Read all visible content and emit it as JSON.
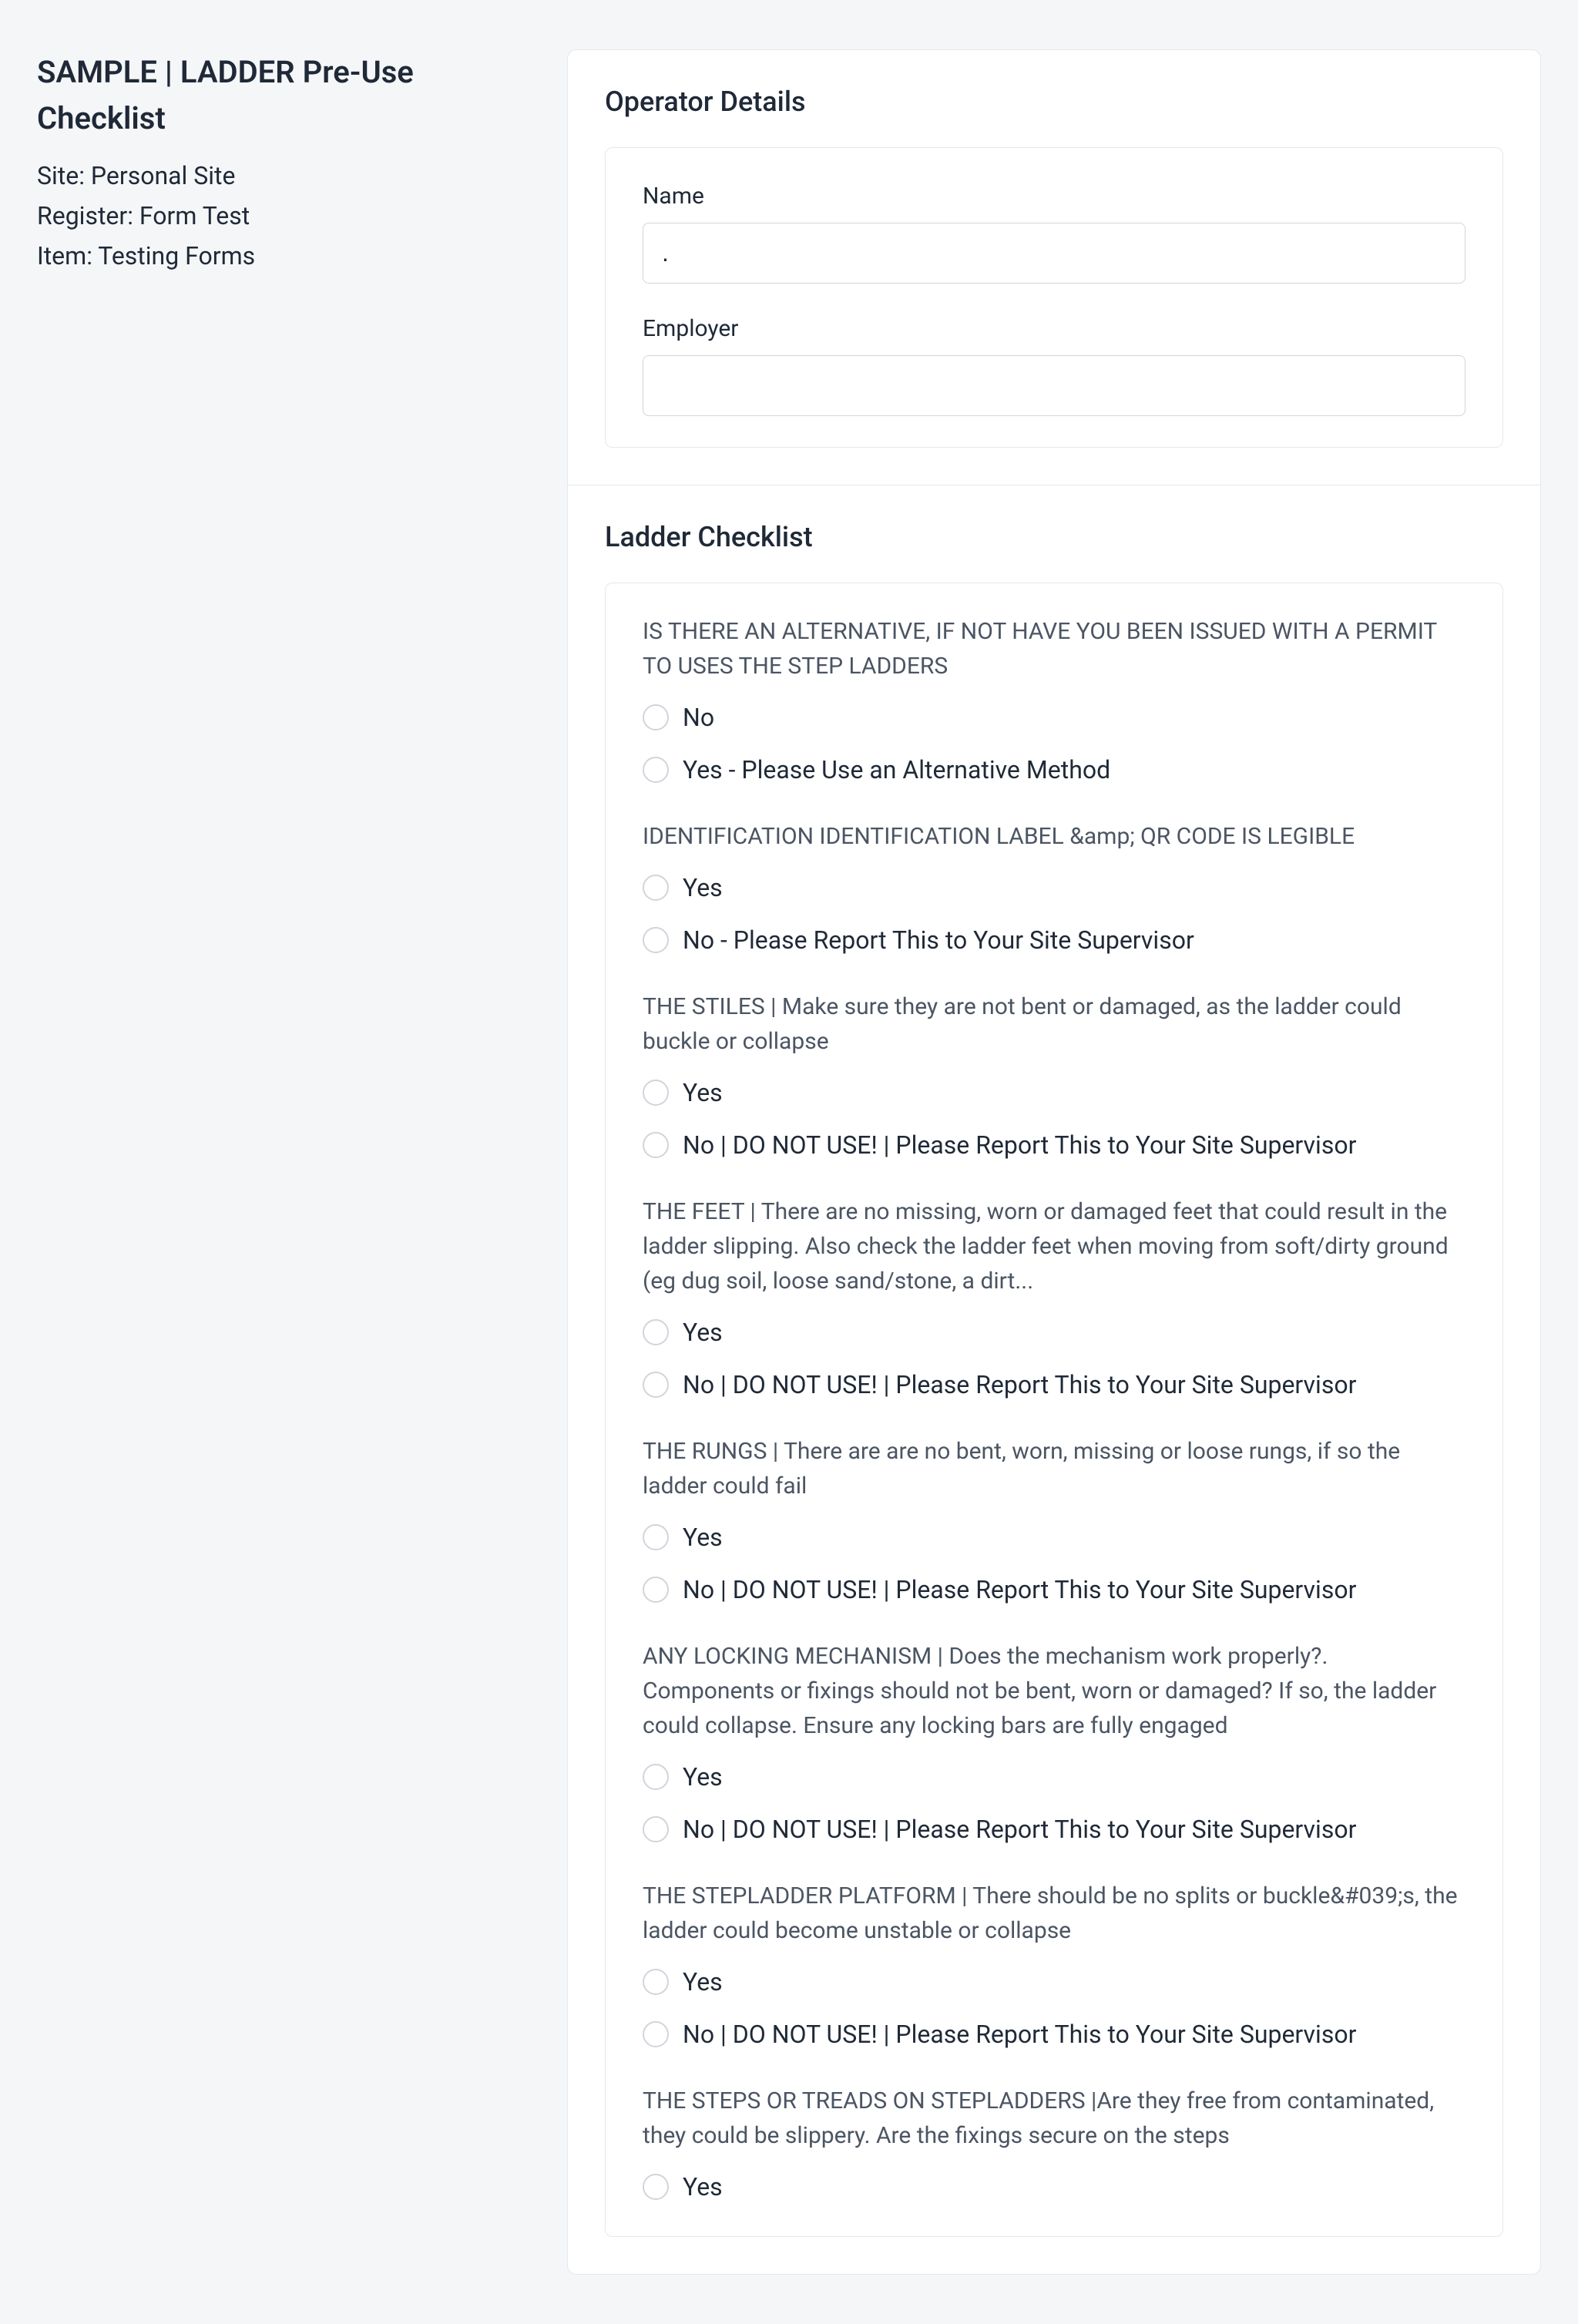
{
  "header": {
    "title": "SAMPLE | LADDER Pre-Use Checklist",
    "site_label": "Site:",
    "site_value": "Personal Site",
    "register_label": "Register:",
    "register_value": "Form Test",
    "item_label": "Item:",
    "item_value": "Testing Forms"
  },
  "sections": {
    "operator": {
      "title": "Operator Details",
      "fields": {
        "name": {
          "label": "Name",
          "value": "."
        },
        "employer": {
          "label": "Employer",
          "value": ""
        }
      }
    },
    "checklist": {
      "title": "Ladder Checklist",
      "questions": [
        {
          "text": "IS THERE AN ALTERNATIVE, IF NOT HAVE YOU BEEN ISSUED WITH A PERMIT TO USES THE STEP LADDERS",
          "options": [
            "No",
            "Yes - Please Use an Alternative Method"
          ]
        },
        {
          "text": "IDENTIFICATION IDENTIFICATION LABEL &amp; QR CODE IS LEGIBLE",
          "options": [
            "Yes",
            "No - Please Report This to Your Site Supervisor"
          ]
        },
        {
          "text": "THE STILES | Make sure they are not bent or damaged, as the ladder could buckle or collapse",
          "options": [
            "Yes",
            "No | DO NOT USE! | Please Report This to Your Site Supervisor"
          ]
        },
        {
          "text": "THE FEET | There are no missing, worn or damaged feet that could result in the ladder slipping. Also check the ladder feet when moving from soft/dirty ground (eg dug soil, loose sand/stone, a dirt...",
          "options": [
            "Yes",
            "No | DO NOT USE! | Please Report This to Your Site Supervisor"
          ]
        },
        {
          "text": "THE RUNGS | There are are no bent, worn, missing or loose rungs, if so the ladder could fail",
          "options": [
            "Yes",
            "No | DO NOT USE! | Please Report This to Your Site Supervisor"
          ]
        },
        {
          "text": "ANY LOCKING MECHANISM | Does the mechanism work properly?. Components or fixings should not be bent, worn or damaged? If so, the ladder could collapse. Ensure any locking bars are fully engaged",
          "options": [
            "Yes",
            "No | DO NOT USE! | Please Report This to Your Site Supervisor"
          ]
        },
        {
          "text": "THE STEPLADDER PLATFORM | There should be no splits or buckle&#039;s, the ladder could become unstable or collapse",
          "options": [
            "Yes",
            "No | DO NOT USE! | Please Report This to Your Site Supervisor"
          ]
        },
        {
          "text": "THE STEPS OR TREADS ON STEPLADDERS |Are they free from contaminated, they could be slippery. Are the fixings secure on the steps",
          "options": [
            "Yes"
          ]
        }
      ]
    }
  }
}
